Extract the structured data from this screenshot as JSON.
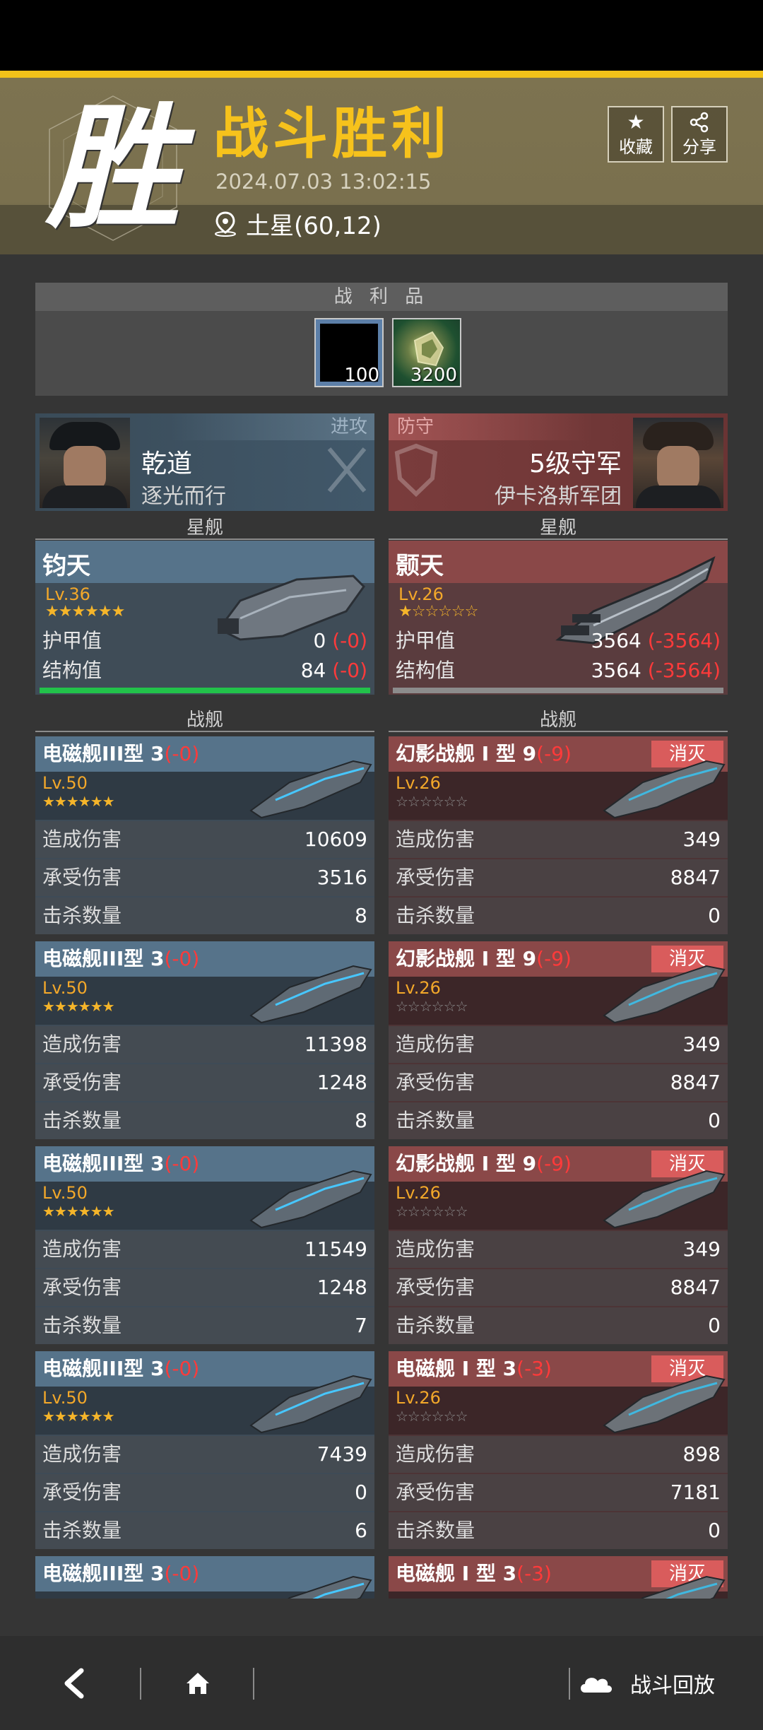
{
  "header": {
    "badge_char": "胜",
    "title": "战斗胜利",
    "datetime": "2024.07.03 13:02:15",
    "location": "土星(60,12)",
    "collect_label": "收藏",
    "share_label": "分享",
    "accent_color": "#f6c21c"
  },
  "spoils": {
    "title": "战 利 品",
    "items": [
      {
        "qty": "100"
      },
      {
        "qty": "3200"
      }
    ]
  },
  "attacker": {
    "tag": "进攻",
    "name": "乾道",
    "org": "逐光而行",
    "flagship_label": "星舰",
    "flagship": {
      "name": "钧天",
      "level": "Lv.36",
      "stars": "★★★★★★",
      "armor_label": "护甲值",
      "armor_value": "0",
      "armor_delta": "(-0)",
      "struct_label": "结构值",
      "struct_value": "84",
      "struct_delta": "(-0)"
    },
    "warships_label": "战舰",
    "ships": [
      {
        "name": "电磁舰III型 3",
        "delta": "(-0)",
        "level": "Lv.50",
        "stars": "★★★★★★",
        "dmg": "10609",
        "taken": "3516",
        "kills": "8"
      },
      {
        "name": "电磁舰III型 3",
        "delta": "(-0)",
        "level": "Lv.50",
        "stars": "★★★★★★",
        "dmg": "11398",
        "taken": "1248",
        "kills": "8"
      },
      {
        "name": "电磁舰III型 3",
        "delta": "(-0)",
        "level": "Lv.50",
        "stars": "★★★★★★",
        "dmg": "11549",
        "taken": "1248",
        "kills": "7"
      },
      {
        "name": "电磁舰III型 3",
        "delta": "(-0)",
        "level": "Lv.50",
        "stars": "★★★★★★",
        "dmg": "7439",
        "taken": "0",
        "kills": "6"
      },
      {
        "name": "电磁舰III型 3",
        "delta": "(-0)"
      }
    ]
  },
  "defender": {
    "tag": "防守",
    "name": "5级守军",
    "org": "伊卡洛斯军团",
    "flagship_label": "星舰",
    "flagship": {
      "name": "颢天",
      "level": "Lv.26",
      "stars": "★☆☆☆☆☆",
      "armor_label": "护甲值",
      "armor_value": "3564",
      "armor_delta": "(-3564)",
      "struct_label": "结构值",
      "struct_value": "3564",
      "struct_delta": "(-3564)"
    },
    "warships_label": "战舰",
    "destroyed_label": "消灭",
    "ships": [
      {
        "name": "幻影战舰 I 型 9",
        "delta": "(-9)",
        "level": "Lv.26",
        "stars": "☆☆☆☆☆☆",
        "dmg": "349",
        "taken": "8847",
        "kills": "0"
      },
      {
        "name": "幻影战舰 I 型 9",
        "delta": "(-9)",
        "level": "Lv.26",
        "stars": "☆☆☆☆☆☆",
        "dmg": "349",
        "taken": "8847",
        "kills": "0"
      },
      {
        "name": "幻影战舰 I 型 9",
        "delta": "(-9)",
        "level": "Lv.26",
        "stars": "☆☆☆☆☆☆",
        "dmg": "349",
        "taken": "8847",
        "kills": "0"
      },
      {
        "name": "电磁舰 I 型 3",
        "delta": "(-3)",
        "level": "Lv.26",
        "stars": "☆☆☆☆☆☆",
        "dmg": "898",
        "taken": "7181",
        "kills": "0"
      },
      {
        "name": "电磁舰 I 型 3",
        "delta": "(-3)"
      }
    ]
  },
  "stat_labels": {
    "dmg": "造成伤害",
    "taken": "承受伤害",
    "kills": "击杀数量"
  },
  "footer": {
    "replay_label": "战斗回放",
    "back_icon": "chevron-left-icon",
    "home_icon": "home-icon",
    "replay_icon": "cloud-icon"
  }
}
